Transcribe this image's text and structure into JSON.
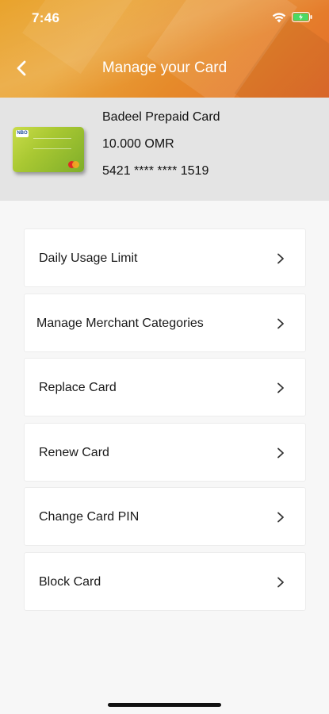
{
  "status_bar": {
    "time": "7:46"
  },
  "nav": {
    "title": "Manage your Card"
  },
  "card": {
    "name": "Badeel Prepaid Card",
    "balance": "10.000 OMR",
    "number": "5421 **** **** 1519",
    "brand_logo_text": "NBO"
  },
  "menu": {
    "items": [
      {
        "label": "Daily Usage Limit"
      },
      {
        "label": "Manage Merchant Categories"
      },
      {
        "label": "Replace Card"
      },
      {
        "label": "Renew Card"
      },
      {
        "label": "Change Card PIN"
      },
      {
        "label": "Block Card"
      }
    ]
  },
  "colors": {
    "header_gradient_start": "#e9a32c",
    "header_gradient_end": "#e46c2c",
    "card_summary_bg": "#e4e4e4",
    "page_bg": "#f7f7f7"
  }
}
